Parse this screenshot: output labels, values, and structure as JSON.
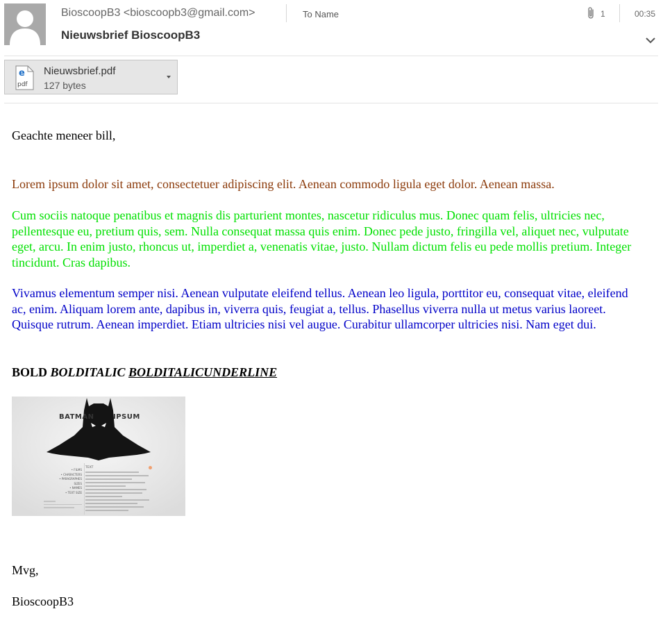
{
  "header": {
    "sender_name": "BioscoopB3",
    "sender_email": "<bioscoopb3@gmail.com>",
    "to": "To Name",
    "subject": "Nieuwsbrief BioscoopB3",
    "attachment_count": "1",
    "time": "00:35"
  },
  "attachment": {
    "filename": "Nieuwsbrief.pdf",
    "size": "127 bytes",
    "icon": "pdf-icon"
  },
  "body": {
    "greeting": "Geachte meneer bill,",
    "paragraph_brown": "Lorem ipsum dolor sit amet, consectetuer adipiscing elit. Aenean commodo ligula eget dolor. Aenean massa.",
    "paragraph_green": "Cum sociis natoque penatibus et magnis dis parturient montes, nascetur ridiculus mus. Donec quam felis, ultricies nec, pellentesque eu, pretium quis, sem. Nulla consequat massa quis enim. Donec pede justo, fringilla vel, aliquet nec, vulputate eget, arcu. In enim justo, rhoncus ut, imperdiet a, venenatis vitae, justo. Nullam dictum felis eu pede mollis pretium. Integer tincidunt. Cras dapibus.",
    "paragraph_blue": "Vivamus elementum semper nisi. Aenean vulputate eleifend tellus. Aenean leo ligula, porttitor eu, consequat vitae, eleifend ac, enim. Aliquam lorem ante, dapibus in, viverra quis, feugiat a, tellus. Phasellus viverra nulla ut metus varius laoreet. Quisque rutrum. Aenean imperdiet. Etiam ultricies nisi vel augue. Curabitur ullamcorper ultricies nisi. Nam eget dui.",
    "bold": "BOLD",
    "bolditalic": "BOLDITALIC",
    "bolditalicunderline": "BOLDITALICUNDERLINE",
    "closing": "Mvg,",
    "signature": "BioscoopB3"
  },
  "image": {
    "title_left": "BATMAN",
    "title_right": "IPSUM",
    "menu": [
      "• FILMS",
      "• CHARACTERS",
      "• PARAGRAPHES SIZES",
      "• NAMES",
      "• TEXT SIZE"
    ],
    "text_heading": "TEXT"
  },
  "colors": {
    "brown": "#8b3a0a",
    "green": "#00e000",
    "blue": "#0000c8"
  }
}
